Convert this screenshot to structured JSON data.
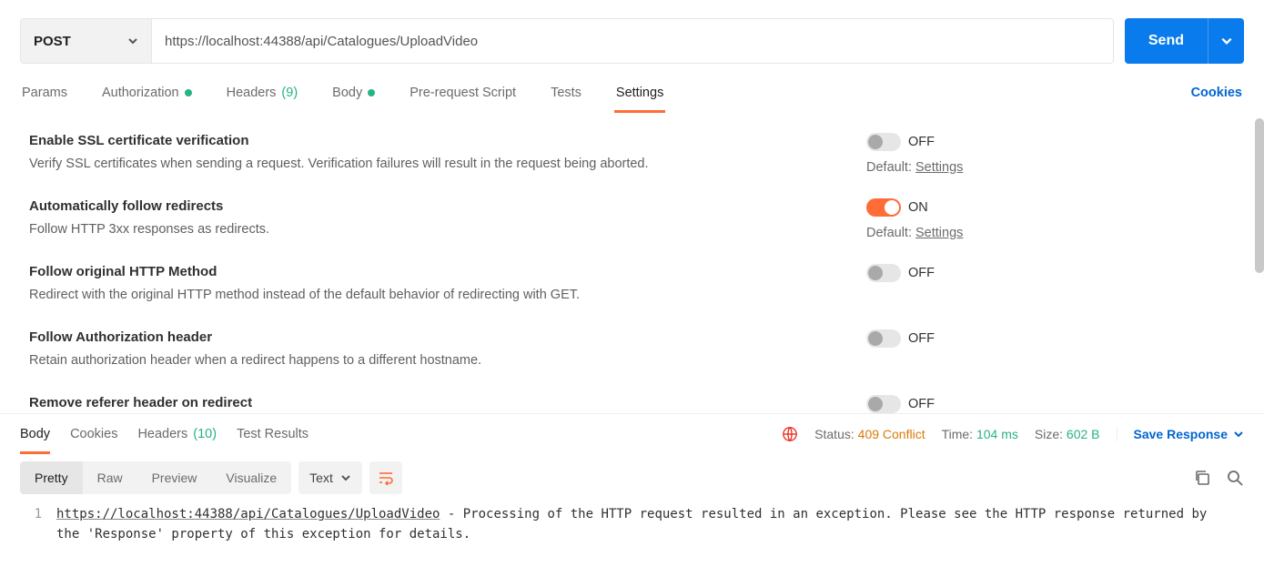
{
  "request": {
    "method": "POST",
    "url": "https://localhost:44388/api/Catalogues/UploadVideo",
    "send_label": "Send"
  },
  "request_tabs": {
    "params": "Params",
    "authorization": "Authorization",
    "headers": "Headers",
    "headers_count": "(9)",
    "body": "Body",
    "pre_request": "Pre-request Script",
    "tests": "Tests",
    "settings": "Settings",
    "cookies": "Cookies"
  },
  "settings": [
    {
      "title": "Enable SSL certificate verification",
      "desc": "Verify SSL certificates when sending a request. Verification failures will result in the request being aborted.",
      "on": false,
      "default_link": "Settings"
    },
    {
      "title": "Automatically follow redirects",
      "desc": "Follow HTTP 3xx responses as redirects.",
      "on": true,
      "default_link": "Settings"
    },
    {
      "title": "Follow original HTTP Method",
      "desc": "Redirect with the original HTTP method instead of the default behavior of redirecting with GET.",
      "on": false
    },
    {
      "title": "Follow Authorization header",
      "desc": "Retain authorization header when a redirect happens to a different hostname.",
      "on": false
    },
    {
      "title": "Remove referer header on redirect",
      "desc": "",
      "on": false
    }
  ],
  "toggle_labels": {
    "on": "ON",
    "off": "OFF",
    "default_prefix": "Default: "
  },
  "response_tabs": {
    "body": "Body",
    "cookies": "Cookies",
    "headers": "Headers",
    "headers_count": "(10)",
    "test_results": "Test Results"
  },
  "response_meta": {
    "status_label": "Status:",
    "status_value": "409 Conflict",
    "time_label": "Time:",
    "time_value": "104 ms",
    "size_label": "Size:",
    "size_value": "602 B",
    "save_response": "Save Response"
  },
  "view_modes": {
    "pretty": "Pretty",
    "raw": "Raw",
    "preview": "Preview",
    "visualize": "Visualize"
  },
  "format": "Text",
  "response_body": {
    "line_no": "1",
    "url": "https://localhost:44388/api/Catalogues/UploadVideo",
    "text": " - Processing of the HTTP request resulted in an exception. Please see the HTTP response returned by the 'Response' property of this exception for details."
  }
}
